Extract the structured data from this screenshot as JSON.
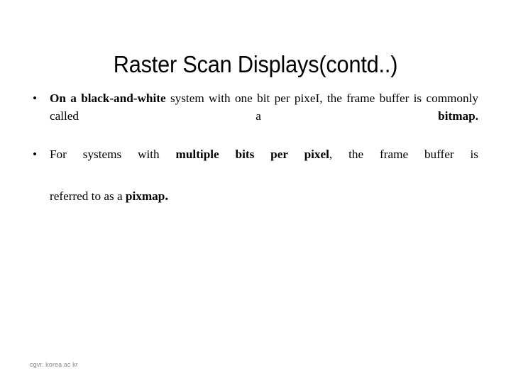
{
  "slide": {
    "title": "Raster Scan Displays(contd..)",
    "background_color": "#ffffff",
    "text_color": "#000000",
    "footer": {
      "text": "cgvr. korea ac kr",
      "color": "#8a8a8a"
    },
    "bullets": [
      {
        "marker": "•",
        "segments": [
          {
            "text": "On a black-and-white",
            "bold": true
          },
          {
            "text": " system with one bit per pixeI, the frame buffer is commonly called a ",
            "bold": false
          },
          {
            "text": "bitmap.",
            "bold": true
          }
        ],
        "plain_text": "On a black-and-white system with one bit per pixeI, the frame buffer is commonly called a bitmap."
      },
      {
        "marker": "•",
        "segments": [
          {
            "text": "For systems with ",
            "bold": false
          },
          {
            "text": "multiple bits per pixel",
            "bold": true
          },
          {
            "text": ", the frame buffer is ",
            "bold": false
          }
        ],
        "tail_segments": [
          {
            "text": "referred to as a ",
            "bold": false
          },
          {
            "text": "pixmap",
            "bold": true
          },
          {
            "text": ".",
            "bold": true,
            "large": true
          }
        ],
        "plain_text": "For systems with multiple bits per pixel, the frame buffer is referred to as a pixmap."
      }
    ]
  }
}
